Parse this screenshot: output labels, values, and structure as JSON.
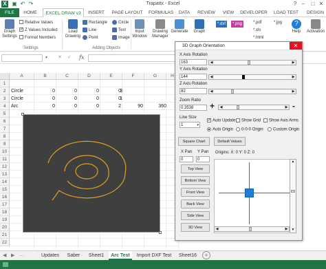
{
  "window": {
    "title": "Trapattx - Excel"
  },
  "tabs": [
    {
      "label": "FILE"
    },
    {
      "label": "HOME"
    },
    {
      "label": "EXCEL DRAW v3"
    },
    {
      "label": "INSERT"
    },
    {
      "label": "PAGE LAYOUT"
    },
    {
      "label": "FORMULAS"
    },
    {
      "label": "DATA"
    },
    {
      "label": "REVIEW"
    },
    {
      "label": "VIEW"
    },
    {
      "label": "DEVELOPER"
    },
    {
      "label": "LOAD TEST"
    },
    {
      "label": "DESIGN"
    }
  ],
  "ribbon": {
    "graph_settings": "Graph Settings",
    "relative_values": "Relative Values",
    "z_values_included": "Z Values Included",
    "format_numbers": "Format Numbers",
    "settings_group": "Settings",
    "load_drawing": "Load Drawing",
    "rectangle": "Rectangle",
    "circle": "Circle",
    "line": "Line",
    "text": "Text",
    "point": "Point",
    "image": "Image",
    "adding_group": "Adding Objects",
    "input_window": "Input Window",
    "drawing_manager": "Drawing Manager",
    "generate": "Generate",
    "graph": "Graph",
    "files": [
      "*.dxf",
      "*.png",
      "*.pdf",
      "*.xls",
      "*.html",
      "*.jpg"
    ],
    "help": "Help",
    "activation": "Activation"
  },
  "formula_bar": {
    "fx": "fx"
  },
  "grid": {
    "columns": [
      "A",
      "B",
      "C",
      "D",
      "E",
      "F",
      "G",
      "H"
    ],
    "rows": [
      "1",
      "2",
      "3",
      "4",
      "5",
      "6",
      "7",
      "8",
      "9",
      "10",
      "11",
      "12",
      "13",
      "14",
      "15",
      "16",
      "17",
      "18",
      "19",
      "20",
      "21",
      "22"
    ],
    "row2": [
      "Circle",
      "0",
      "0",
      "0",
      "0",
      "3"
    ],
    "row3": [
      "Circle",
      "0",
      "0",
      "0",
      "0",
      "1"
    ],
    "row4": [
      "Arc",
      "0",
      "0",
      "0",
      "2",
      "90",
      "360"
    ]
  },
  "sheets": [
    "Updates",
    "Saber",
    "Sheet1",
    "Arc Test",
    "Import DXF Test",
    "Sheet16"
  ],
  "dialog": {
    "title": "3D Graph Orientation",
    "x_axis_label": "X Axis Rotation",
    "x_axis_value": "163",
    "y_axis_label": "Y Axis Rotation",
    "y_axis_value": "144",
    "z_axis_label": "Z Axis Rotation",
    "z_axis_value": "82",
    "zoom_label": "Zoom Ratio",
    "zoom_value": "0.3538",
    "plus": "+",
    "minus": "-",
    "line_size_label": "Line Size",
    "line_size_value": "1",
    "auto_update": "Auto Update",
    "show_grid": "Show Grid",
    "show_axis_arms": "Show Axis Arms",
    "auto_origin": "Auto Origin",
    "origin_000": "0-0-0 Origin",
    "custom_origin": "Custom Origin",
    "square_chart": "Square Chart",
    "default_values": "Default Values",
    "x_pan": "X Pan",
    "y_pan": "Y Pan",
    "x_pan_value": "0",
    "y_pan_value": "0",
    "origins": "Origins: X: 0 Y: 0 Z: 0",
    "top_view": "Top View",
    "bottom_view": "Bottom View",
    "front_view": "Front View",
    "back_view": "Back View",
    "side_view": "Side View",
    "view_3d": "3D View",
    "colors": {
      "accent": "#217346",
      "marker": "#1e7fd8",
      "close": "#e81123",
      "chart_bg": "#3f3f3f",
      "spiral": "#e0a020"
    }
  }
}
